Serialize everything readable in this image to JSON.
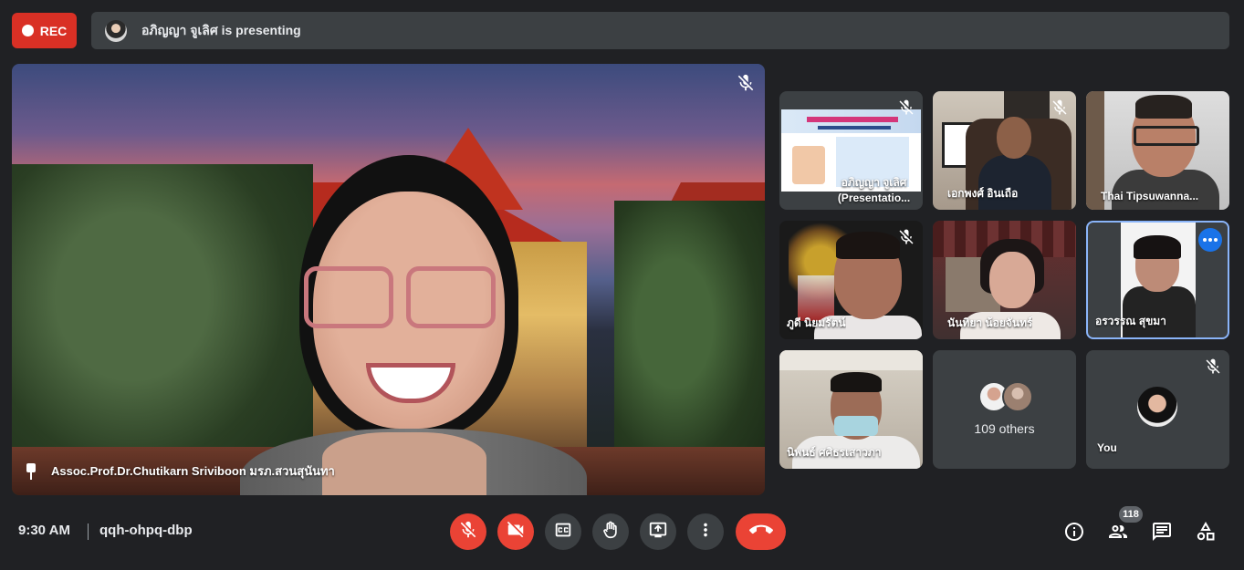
{
  "recording": {
    "label": "REC"
  },
  "banner": {
    "presenting_text": "อภิญญา จูเลิศ is presenting"
  },
  "main_video": {
    "participant_name": "Assoc.Prof.Dr.Chutikarn Sriviboon มรภ.สวนสุนันทา",
    "muted": true,
    "pinned": true
  },
  "tiles": [
    {
      "name": "อภิญญา จูเลิศ (Presentatio...",
      "muted": true
    },
    {
      "name": "เอกพงศ์ อินเถือ",
      "muted": true
    },
    {
      "name": "Thai Tipsuwanna...",
      "muted": false
    },
    {
      "name": "ภูดี นิยมรัตน์",
      "muted": true
    },
    {
      "name": "นันทิยา น้อยจันทร์",
      "muted": false
    },
    {
      "name": "อรวรรณ สุขมา",
      "muted": false,
      "active": true
    },
    {
      "name": "นิพนธ์ ศศิธรเสาวภา",
      "muted": false
    },
    {
      "name": "109 others",
      "muted": false
    },
    {
      "name": "You",
      "muted": true
    }
  ],
  "bottom_bar": {
    "time": "9:30 AM",
    "meeting_code": "qqh-ohpq-dbp",
    "people_count": "118"
  },
  "icons": {
    "mic": "mic-off-icon",
    "camera": "camera-off-icon",
    "captions": "captions-icon",
    "hand": "raise-hand-icon",
    "present": "present-now-icon",
    "more": "more-vert-icon",
    "end": "end-call-icon",
    "info": "info-icon",
    "people": "people-icon",
    "chat": "chat-icon",
    "activities": "activities-icon"
  },
  "colors": {
    "background": "#202124",
    "surface": "#3c4043",
    "red": "#ea4335",
    "accent": "#8ab4f8",
    "blue": "#1a73e8"
  }
}
